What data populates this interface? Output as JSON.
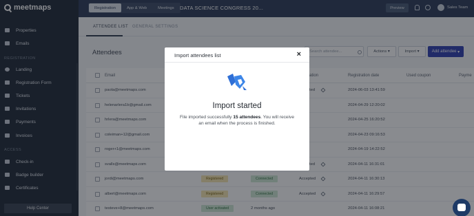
{
  "sidebar": {
    "logo_text": "meetmaps",
    "items": [
      {
        "label": "Properties"
      },
      {
        "label": "Emails"
      }
    ],
    "section_registration": "REGISTRATION",
    "registration_items": [
      {
        "label": "Landing"
      },
      {
        "label": "Registration Form"
      },
      {
        "label": "Tickets"
      },
      {
        "label": "Invitations"
      },
      {
        "label": "Payments"
      },
      {
        "label": "Invoices"
      }
    ],
    "section_access": "ACCESS",
    "access_items": [
      {
        "label": "Check-in"
      },
      {
        "label": "Badge builder"
      },
      {
        "label": "Certificates"
      }
    ],
    "help_label": "Help Center"
  },
  "topbar": {
    "tabs": [
      {
        "label": "Registration"
      },
      {
        "label": "App & Web"
      },
      {
        "label": "Meetings"
      }
    ],
    "event_title": "DATA SCIENCE CONGRESS 20...",
    "preview_label": "Preview",
    "team_label": "Sales Team"
  },
  "subtabs": {
    "attendee_list": "ATTENDEE LIST",
    "general_settings": "GENERAL SETTINGS"
  },
  "main": {
    "title": "Attendees",
    "search_placeholder": "Search attendee...",
    "actions_label": "Actions",
    "import_label": "Import",
    "add_label": "Add attendee",
    "columns": {
      "email": "Email",
      "validation": "ation",
      "registration_date": "Registration date",
      "used_coupon": "Used coupon",
      "payment": "Payme"
    },
    "rows": [
      {
        "email": "paola@meetmaps.com",
        "validation": "ted",
        "date": "2024-06-03 13:41:59"
      },
      {
        "email": "helenarlera1b@gmail.com",
        "validation": "",
        "date": "2024-04-29 12:20:02"
      },
      {
        "email": "hrlera@meetmaps.com",
        "validation": "",
        "date": "2024-04-25 16:20:52"
      },
      {
        "email": "coleiman+12@gmail.com",
        "validation": "",
        "date": "2024-04-23 09:16:53"
      },
      {
        "email": "roger+1@meetmaps.com",
        "validation": "",
        "date": "2024-04-19 14:22:52"
      },
      {
        "email": "svalls@meetmaps.com",
        "validation": "ted",
        "date": "2024-04-11 16:31:01"
      },
      {
        "email": "jordi@meetmaps.com",
        "status": "Registered",
        "connection": "Connected",
        "validation": "Accepted",
        "date": "2024-04-11 16:30:13"
      },
      {
        "email": "albert@meetmaps.com",
        "status": "Registered",
        "connection": "Connected",
        "validation": "Accepted",
        "date": "2024-04-11 16:29:57"
      },
      {
        "email": "testeve+8@meetmaps.com",
        "status": "User activated",
        "connection": "2 months ago",
        "validation": "",
        "date": "2024-04-11 16:08:21"
      }
    ]
  },
  "modal": {
    "title": "Import attendees list",
    "close_glyph": "×",
    "heading": "Import started",
    "msg_before": "File imported successfully ",
    "msg_bold": "15 attendees",
    "msg_after": ". You will receive an email when the process is finished."
  },
  "colors": {
    "sidebar_bg": "#1f2937",
    "topbar_bg": "#2c3b58",
    "primary": "#2f3fb0",
    "brand_blue": "#2f6fd6"
  }
}
